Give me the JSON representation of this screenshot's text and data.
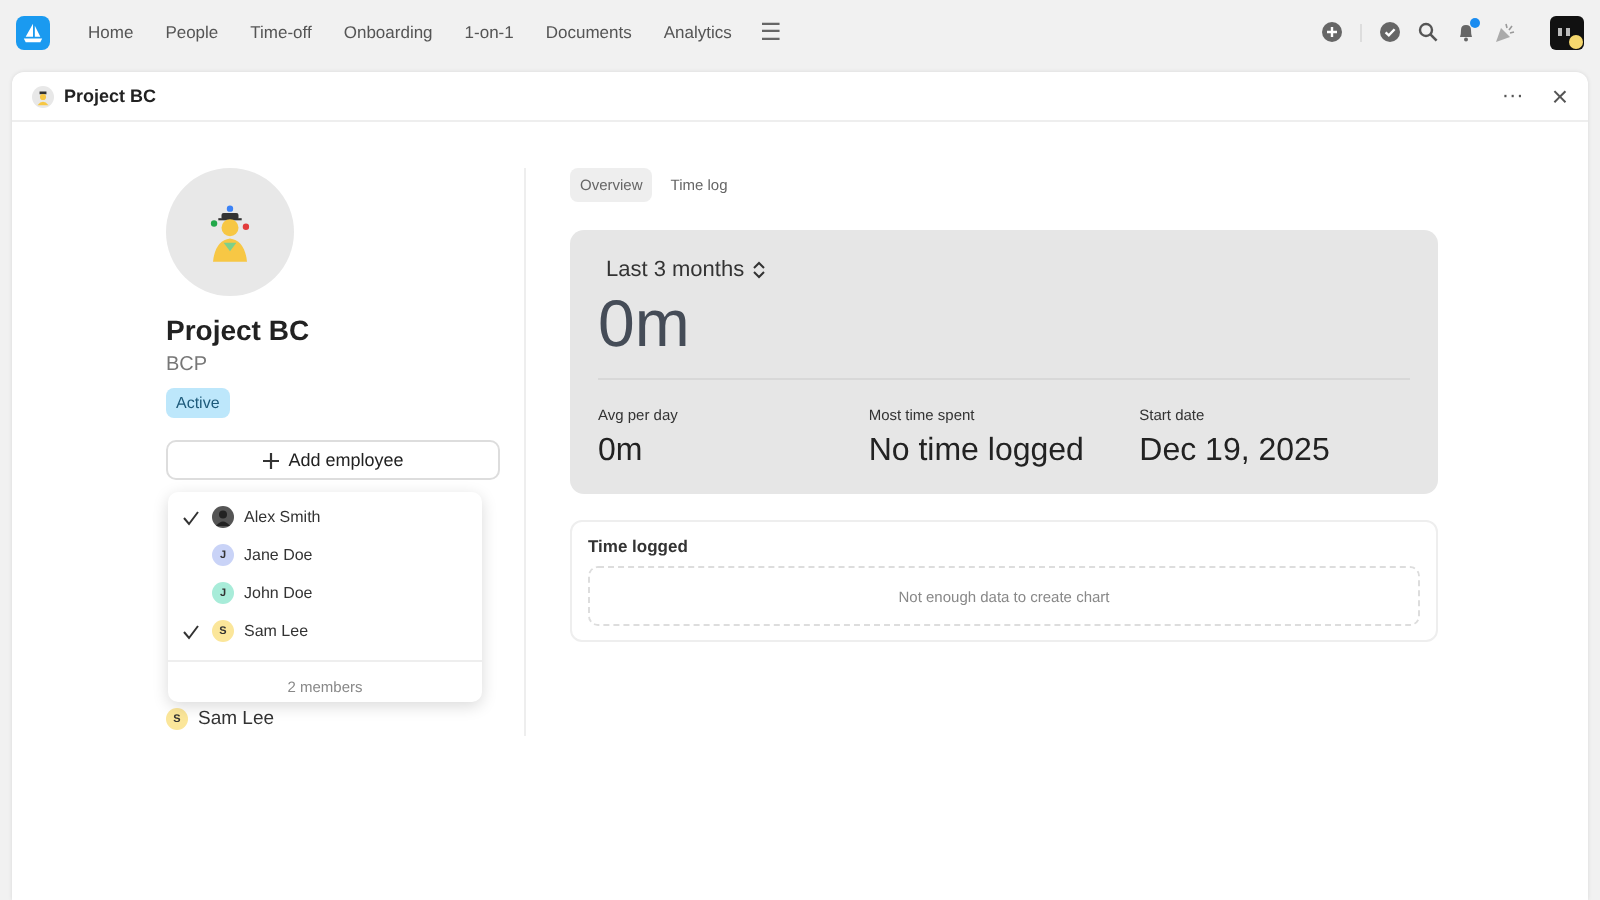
{
  "nav": {
    "items": [
      {
        "label": "Home"
      },
      {
        "label": "People"
      },
      {
        "label": "Time-off"
      },
      {
        "label": "Onboarding"
      },
      {
        "label": "1-on-1"
      },
      {
        "label": "Documents"
      },
      {
        "label": "Analytics"
      }
    ],
    "menu_icon": "☰",
    "notification_dot": true
  },
  "panel": {
    "title": "Project BC",
    "more": "···",
    "close": "×"
  },
  "project": {
    "name": "Project BC",
    "code": "BCP",
    "status": "Active",
    "add_button": "Add employee",
    "dropdown": [
      {
        "name": "Alex Smith",
        "kind": "photo",
        "checked": true
      },
      {
        "name": "Jane Doe",
        "kind": "initial",
        "initial": "J",
        "color": "#c9d3f7",
        "checked": false
      },
      {
        "name": "John Doe",
        "kind": "initial",
        "initial": "J",
        "color": "#a8ecd9",
        "checked": false
      },
      {
        "name": "Sam Lee",
        "kind": "initial",
        "initial": "S",
        "color": "#fbe69a",
        "checked": true
      }
    ],
    "dropdown_footer": "2 members",
    "members": [
      {
        "name": "Sam Lee",
        "initial": "S",
        "color": "#fbe69a"
      }
    ]
  },
  "tabs": [
    {
      "label": "Overview",
      "selected": true
    },
    {
      "label": "Time log",
      "selected": false
    }
  ],
  "summary": {
    "range": "Last 3 months",
    "total": "0m",
    "stats": [
      {
        "label": "Avg per day",
        "value": "0m"
      },
      {
        "label": "Most time spent",
        "value": "No time logged"
      },
      {
        "label": "Start date",
        "value": "Dec 19, 2025"
      }
    ]
  },
  "time_logged": {
    "title": "Time logged",
    "empty": "Not enough data to create chart"
  }
}
